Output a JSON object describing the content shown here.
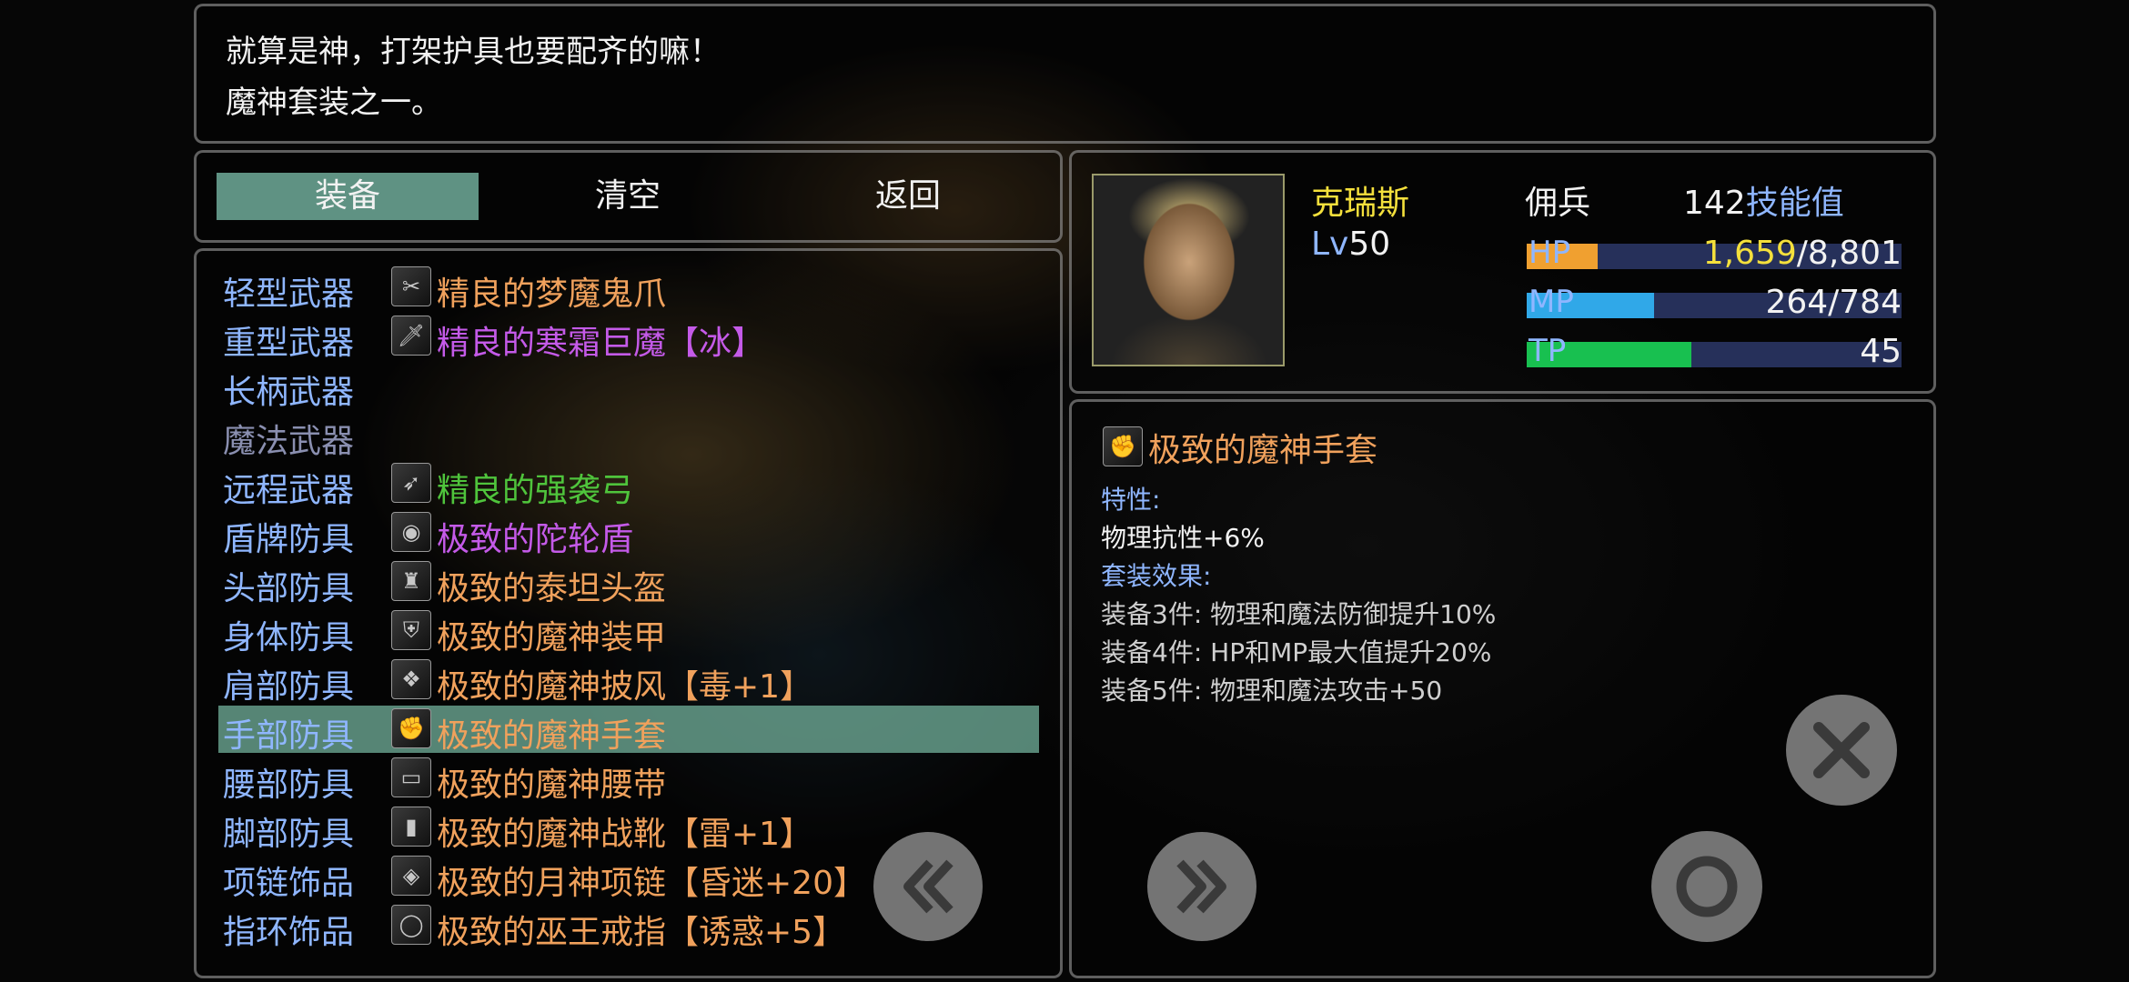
{
  "description": {
    "line1": "就算是神，打架护具也要配齐的嘛！",
    "line2": "魔神套装之一。"
  },
  "tabs": [
    {
      "label": "装备",
      "active": true
    },
    {
      "label": "清空",
      "active": false
    },
    {
      "label": "返回",
      "active": false
    }
  ],
  "slots": [
    {
      "label": "轻型武器",
      "item": "精良的梦魔鬼爪",
      "item_color": "#f0a15c",
      "icon": "claw-icon",
      "dim": false,
      "selected": false
    },
    {
      "label": "重型武器",
      "item": "精良的寒霜巨魔【冰】",
      "item_color": "#c45ae8",
      "icon": "sword-icon",
      "dim": false,
      "selected": false
    },
    {
      "label": "长柄武器",
      "item": "",
      "item_color": "#f0a15c",
      "icon": "",
      "dim": false,
      "selected": false
    },
    {
      "label": "魔法武器",
      "item": "",
      "item_color": "#f0a15c",
      "icon": "",
      "dim": true,
      "selected": false
    },
    {
      "label": "远程武器",
      "item": "精良的强袭弓",
      "item_color": "#4fc43c",
      "icon": "bow-icon",
      "dim": false,
      "selected": false
    },
    {
      "label": "盾牌防具",
      "item": "极致的陀轮盾",
      "item_color": "#c45ae8",
      "icon": "shield-icon",
      "dim": false,
      "selected": false
    },
    {
      "label": "头部防具",
      "item": "极致的泰坦头盔",
      "item_color": "#f0a15c",
      "icon": "helmet-icon",
      "dim": false,
      "selected": false
    },
    {
      "label": "身体防具",
      "item": "极致的魔神装甲",
      "item_color": "#f0a15c",
      "icon": "armor-icon",
      "dim": false,
      "selected": false
    },
    {
      "label": "肩部防具",
      "item": "极致的魔神披风【毒+1】",
      "item_color": "#f0a15c",
      "icon": "cape-icon",
      "dim": false,
      "selected": false
    },
    {
      "label": "手部防具",
      "item": "极致的魔神手套",
      "item_color": "#f0a15c",
      "icon": "gauntlet-icon",
      "dim": false,
      "selected": true
    },
    {
      "label": "腰部防具",
      "item": "极致的魔神腰带",
      "item_color": "#f0a15c",
      "icon": "belt-icon",
      "dim": false,
      "selected": false
    },
    {
      "label": "脚部防具",
      "item": "极致的魔神战靴【雷+1】",
      "item_color": "#f0a15c",
      "icon": "boots-icon",
      "dim": false,
      "selected": false
    },
    {
      "label": "项链饰品",
      "item": "极致的月神项链【昏迷+20】",
      "item_color": "#f0a15c",
      "icon": "necklace-icon",
      "dim": false,
      "selected": false
    },
    {
      "label": "指环饰品",
      "item": "极致的巫王戒指【诱惑+5】",
      "item_color": "#f0a15c",
      "icon": "ring-icon",
      "dim": false,
      "selected": false
    }
  ],
  "character": {
    "name": "克瑞斯",
    "level_prefix": "Lv",
    "level": "50",
    "class": "佣兵",
    "skill_points": "142",
    "skill_label": "技能值",
    "hp": {
      "label": "HP",
      "current": "1,659",
      "max": "/8,801",
      "fraction": 0.19,
      "color": "#f0a030"
    },
    "mp": {
      "label": "MP",
      "value": "264/784",
      "fraction": 0.34,
      "color": "#30a8e8"
    },
    "tp": {
      "label": "TP",
      "value": "45",
      "fraction": 0.44,
      "color": "#18c050"
    }
  },
  "detail": {
    "name": "极致的魔神手套",
    "trait_header": "特性:",
    "trait": "物理抗性+6%",
    "set_header": "套装效果:",
    "set_effects": [
      "装备3件:  物理和魔法防御提升10%",
      "装备4件:  HP和MP最大值提升20%",
      "装备5件:  物理和魔法攻击+50"
    ]
  },
  "colors": {
    "slot_label": "#8fb6ff",
    "name_gold": "#f4e03c",
    "hp_value": "#f4e03c",
    "item_orange": "#f0a15c",
    "item_purple": "#c45ae8",
    "item_green": "#4fc43c"
  }
}
